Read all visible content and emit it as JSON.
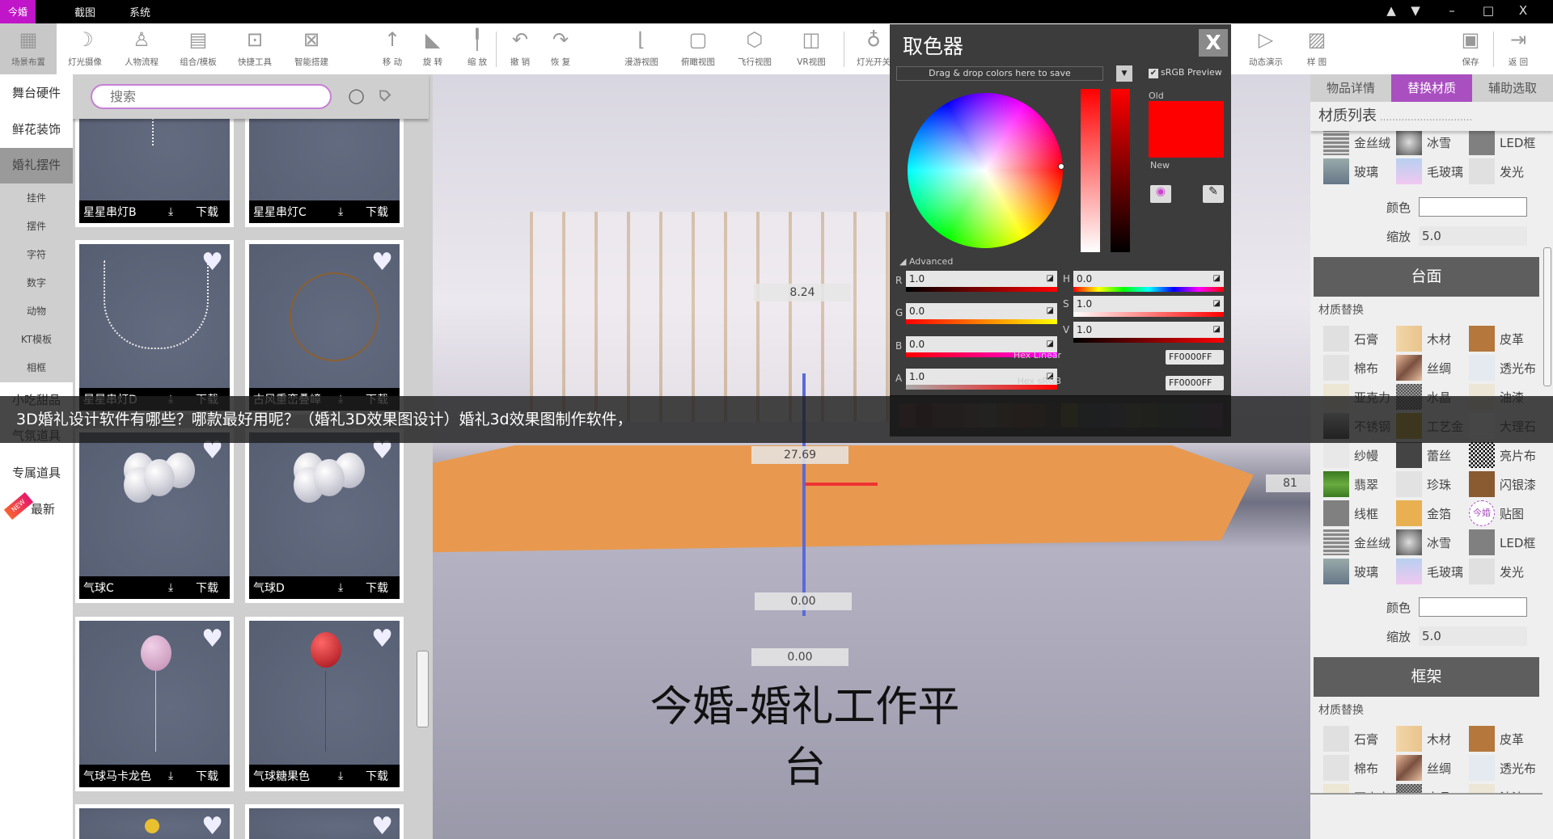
{
  "app": {
    "logo_text": "今婚",
    "menu": [
      "截图",
      "系统"
    ],
    "window_controls": [
      "▲",
      "▼",
      "–",
      "□",
      "X"
    ]
  },
  "toolbar": {
    "left": [
      {
        "label": "场景布置",
        "icon": "grid-icon",
        "active": true
      },
      {
        "label": "灯光摄像",
        "icon": "lamp-icon"
      },
      {
        "label": "人物流程",
        "icon": "person-icon"
      },
      {
        "label": "组合/模板",
        "icon": "template-icon"
      },
      {
        "label": "快捷工具",
        "icon": "toolbox-icon"
      },
      {
        "label": "智能搭建",
        "icon": "smart-build-icon"
      },
      {
        "label": "移 动",
        "icon": "move-arrow-icon"
      },
      {
        "label": "旋 转",
        "icon": "rotate-icon"
      },
      {
        "label": "缩 放",
        "icon": "scale-icon"
      },
      {
        "label": "撤 销",
        "icon": "undo-icon"
      },
      {
        "label": "恢 复",
        "icon": "redo-icon"
      },
      {
        "label": "漫游视图",
        "icon": "roam-view-icon"
      },
      {
        "label": "俯瞰视图",
        "icon": "top-view-icon"
      },
      {
        "label": "飞行视图",
        "icon": "cube-icon"
      },
      {
        "label": "VR视图",
        "icon": "vr-icon"
      },
      {
        "label": "灯光开关",
        "icon": "bulb-icon"
      }
    ],
    "right": [
      {
        "label": "动态演示",
        "icon": "play-icon"
      },
      {
        "label": "样 图",
        "icon": "image-icon"
      },
      {
        "label": "保存",
        "icon": "save-icon"
      },
      {
        "label": "返 回",
        "icon": "exit-icon"
      }
    ]
  },
  "categories": {
    "main_top": [
      "舞台硬件",
      "鲜花装饰",
      "婚礼摆件"
    ],
    "selected": "婚礼摆件",
    "sub": [
      "挂件",
      "摆件",
      "字符",
      "数字",
      "动物",
      "KT模板",
      "相框"
    ],
    "main_bottom": [
      "小吃甜品",
      "气氛道具",
      "专属道具"
    ],
    "newest": {
      "badge": "NEW",
      "label": "最新"
    }
  },
  "assets": {
    "search_placeholder": "搜索",
    "download_label": "下载",
    "items": [
      {
        "name": "星星串灯B"
      },
      {
        "name": "星星串灯C"
      },
      {
        "name": "星星串灯D"
      },
      {
        "name": "古风重峦叠嶂"
      },
      {
        "name": "气球C"
      },
      {
        "name": "气球D"
      },
      {
        "name": "气球马卡龙色"
      },
      {
        "name": "气球糖果色"
      },
      {
        "name": ""
      },
      {
        "name": ""
      }
    ]
  },
  "viewport": {
    "labels": [
      "8.24",
      "27.69",
      "0.00",
      "0.00",
      "81"
    ],
    "title": "今婚-婚礼工作平台"
  },
  "caption": "3D婚礼设计软件有哪些？哪款最好用呢？（婚礼3D效果图设计）婚礼3d效果图制作软件，",
  "color_picker": {
    "title": "取色器",
    "close": "X",
    "drop_hint": "Drag & drop colors here to save",
    "srgb_preview": "sRGB Preview",
    "srgb_checked": true,
    "old_label": "Old",
    "new_label": "New",
    "advanced": "Advanced",
    "R": "1.0",
    "G": "0.0",
    "B": "0.0",
    "A": "1.0",
    "H": "0.0",
    "S": "1.0",
    "V": "1.0",
    "hex_linear_label": "Hex Linear",
    "hex_linear": "FF0000FF",
    "hex_srgb_label": "Hex sRGB",
    "hex_srgb": "FF0000FF",
    "old_color": "#ff0000",
    "new_color": "#ff0000"
  },
  "right_panel": {
    "tabs": [
      "物品详情",
      "替换材质",
      "辅助选取"
    ],
    "active_tab": "替换材质",
    "list_title": "材质列表",
    "replace_label": "材质替换",
    "color_label": "颜色",
    "scale_label": "缩放",
    "scale_value": "5.0",
    "sections": [
      "",
      "台面",
      "框架"
    ],
    "materials": [
      "石膏",
      "木材",
      "皮革",
      "棉布",
      "丝绸",
      "透光布",
      "亚克力",
      "水晶",
      "油漆",
      "不锈钢",
      "工艺金",
      "大理石",
      "纱幔",
      "蕾丝",
      "亮片布",
      "翡翠",
      "珍珠",
      "闪银漆",
      "线框",
      "金箔",
      "贴图",
      "金丝绒",
      "冰雪",
      "LED框",
      "玻璃",
      "毛玻璃",
      "发光"
    ]
  },
  "colors": {
    "accent": "#a94fc0",
    "logo": "#c015c8",
    "orange": "#e8994f"
  }
}
